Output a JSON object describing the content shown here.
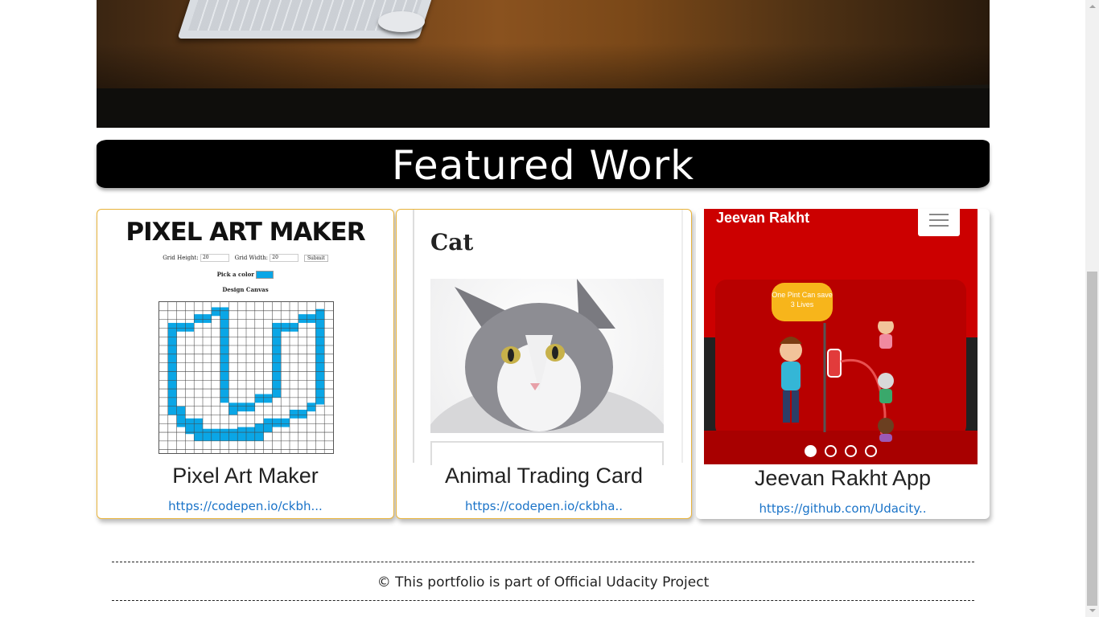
{
  "featured": {
    "heading": "Featured Work"
  },
  "cards": [
    {
      "title": "Pixel Art Maker",
      "link": "https://codepen.io/ckbh...",
      "preview": {
        "logo": "PIXEL ART MAKER",
        "grid_height_label": "Grid Height:",
        "grid_height_value": "20",
        "grid_width_label": "Grid Width:",
        "grid_width_value": "20",
        "submit": "Submit",
        "pick_color": "Pick a color",
        "canvas_title": "Design Canvas",
        "swatch_color": "#0aa6e6"
      }
    },
    {
      "title": "Animal Trading Card",
      "link": "https://codepen.io/ckbha..",
      "preview": {
        "heading": "Cat"
      }
    },
    {
      "title": "Jeevan Rakht App",
      "link": "https://github.com/Udacity..",
      "preview": {
        "brand": "Jeevan Rakht",
        "bubble_line1": "One Pint Can save",
        "bubble_line2": "3 Lives",
        "carousel_count": 4,
        "carousel_active": 1
      }
    }
  ],
  "footer": {
    "text": "© This portfolio is part of Official Udacity Project"
  },
  "colors": {
    "card_border_golden": "#e9b43c",
    "link": "#1a73c8",
    "app_red": "#cc0000",
    "pixel_blue": "#0aa6e6"
  },
  "icons": [
    "hamburger-menu-icon",
    "carousel-indicator-icon",
    "scroll-up-arrow-icon",
    "scroll-down-arrow-icon"
  ]
}
